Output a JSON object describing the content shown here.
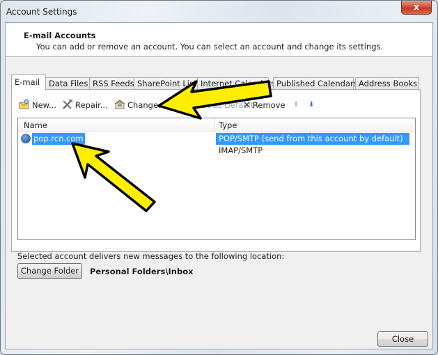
{
  "window": {
    "title": "Account Settings",
    "close_glyph": "x"
  },
  "header": {
    "title": "E-mail Accounts",
    "description": "You can add or remove an account. You can select an account and change its settings."
  },
  "tabs": [
    {
      "label": "E-mail",
      "active": true
    },
    {
      "label": "Data Files",
      "active": false
    },
    {
      "label": "RSS Feeds",
      "active": false
    },
    {
      "label": "SharePoint Lists",
      "active": false
    },
    {
      "label": "Internet Calendars",
      "active": false
    },
    {
      "label": "Published Calendars",
      "active": false
    },
    {
      "label": "Address Books",
      "active": false
    }
  ],
  "toolbar": {
    "new_label": "New...",
    "repair_label": "Repair...",
    "change_label": "Change...",
    "set_default_label": "Set as Default",
    "remove_label": "Remove",
    "remove_glyph": "✕",
    "move_up_glyph": "⬆",
    "move_down_glyph": "⬇"
  },
  "list": {
    "columns": [
      "Name",
      "Type"
    ],
    "rows": [
      {
        "name": "pop.rcn.com",
        "type": "POP/SMTP (send from this account by default)",
        "selected": true,
        "default": true
      },
      {
        "name": "",
        "type": "IMAP/SMTP",
        "selected": false,
        "default": false
      }
    ]
  },
  "delivery": {
    "text": "Selected account delivers new messages to the following location:",
    "change_folder_label": "Change Folder",
    "folder_path": "Personal Folders\\Inbox"
  },
  "footer": {
    "close_label": "Close"
  },
  "annotations": {
    "arrow_color": "#ffee00",
    "arrow_outline": "#000000"
  }
}
